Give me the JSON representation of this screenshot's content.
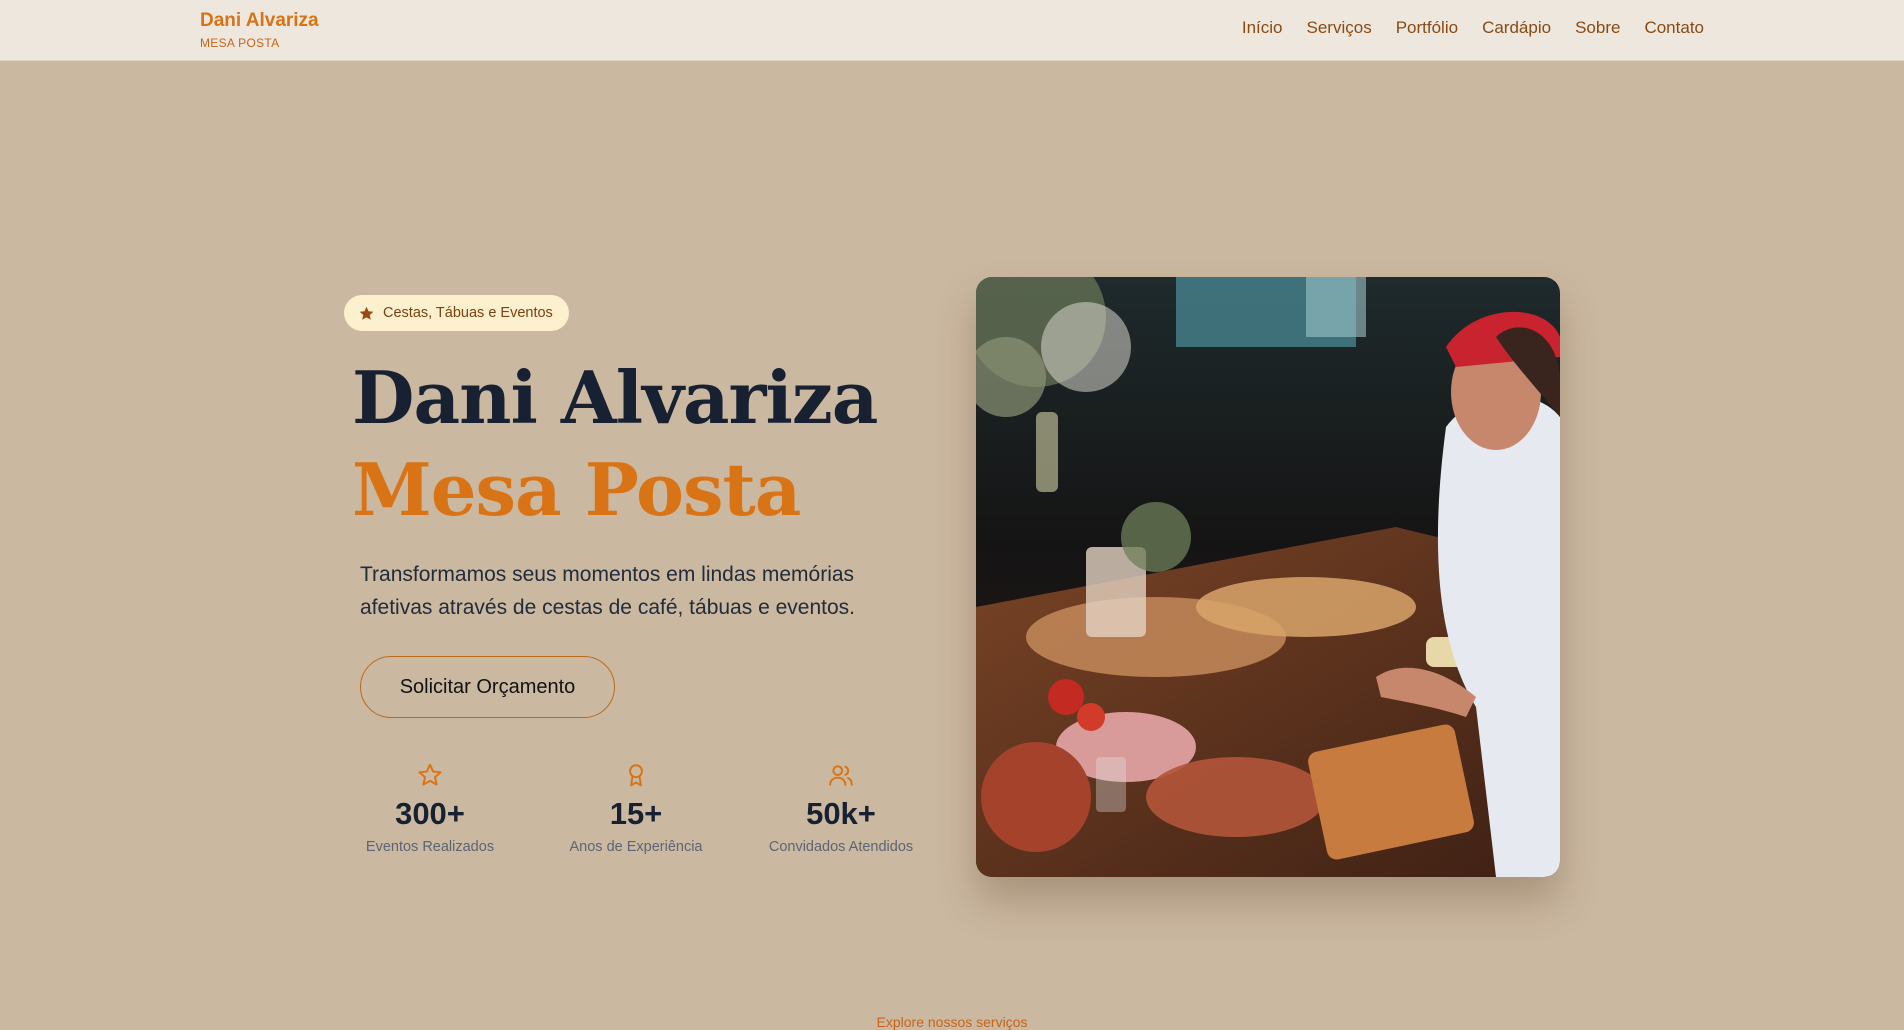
{
  "header": {
    "brand_name": "Dani Alvariza",
    "brand_sub": "MESA POSTA",
    "nav": [
      "Início",
      "Serviços",
      "Portfólio",
      "Cardápio",
      "Sobre",
      "Contato"
    ]
  },
  "hero": {
    "badge": {
      "icon": "star-icon",
      "label": "Cestas, Tábuas e Eventos"
    },
    "title_line1": "Dani Alvariza",
    "title_line2": "Mesa Posta",
    "lead": "Transformamos seus momentos em lindas memórias afetivas através de cestas de café, tábuas e eventos.",
    "cta_label": "Solicitar Orçamento",
    "stats": [
      {
        "icon": "star-outline-icon",
        "value": "300+",
        "label": "Eventos Realizados"
      },
      {
        "icon": "award-icon",
        "value": "15+",
        "label": "Anos de Experiência"
      },
      {
        "icon": "users-icon",
        "value": "50k+",
        "label": "Convidados Atendidos"
      }
    ]
  },
  "explore_label": "Explore nossos serviços",
  "colors": {
    "background": "#cbb8a0",
    "header_bg": "#ede7dd",
    "accent": "#d97416",
    "title": "#182132",
    "badge_bg": "#fcf0cf"
  }
}
